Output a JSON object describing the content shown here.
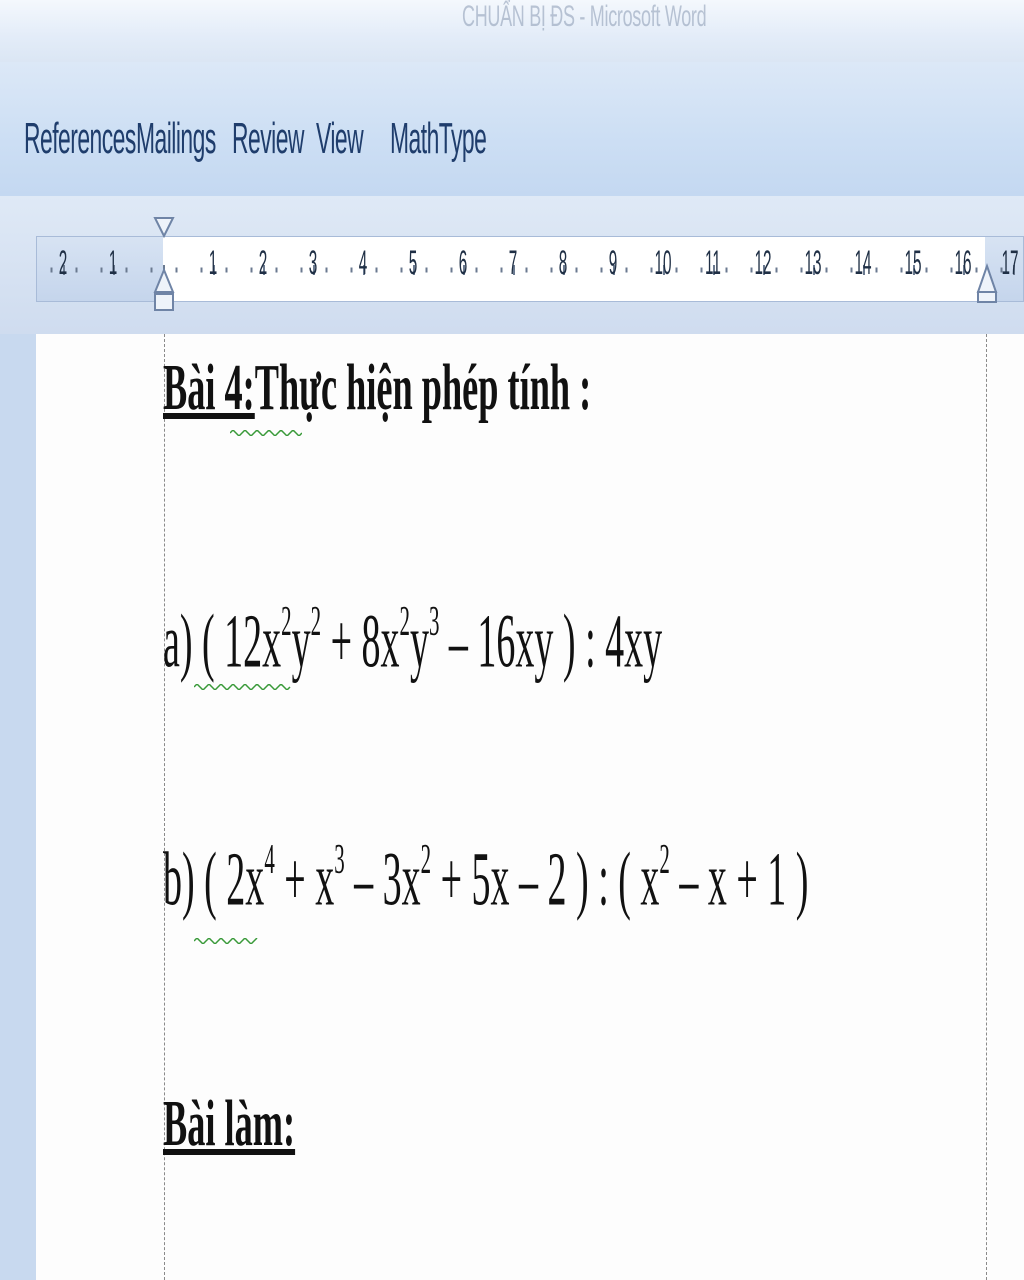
{
  "window": {
    "title": "CHUẨN BỊ ĐS - Microsoft Word"
  },
  "ribbon": {
    "tabs": [
      {
        "label": "References"
      },
      {
        "label": "Mailings"
      },
      {
        "label": "Review"
      },
      {
        "label": "View"
      },
      {
        "label": "MathType"
      }
    ]
  },
  "ruler": {
    "left_labels": [
      "2",
      "1"
    ],
    "labels": [
      "1",
      "2",
      "3",
      "4",
      "5",
      "6",
      "7",
      "8",
      "9",
      "10",
      "11",
      "12",
      "13",
      "14",
      "15",
      "16"
    ],
    "right_label": "17"
  },
  "document": {
    "heading_prefix": "Bài 4:",
    "heading_rest": "Thực hiện phép tính :",
    "expr_a": {
      "p1": "a) ( 12x",
      "s1": "2",
      "p2": "y",
      "s2": "2",
      "p3": " + 8x",
      "s3": "2",
      "p4": "y",
      "s4": "3",
      "p5": " – 16xy ) : 4xy"
    },
    "expr_b": {
      "p1": "b) ( 2x",
      "s1": "4",
      "p2": " + x",
      "s2": "3",
      "p3": " – 3x",
      "s3": "2",
      "p4": " + 5x – 2 ) : ( x",
      "s4": "2",
      "p5": " – x + 1 )"
    },
    "answer_label": "Bài làm:"
  }
}
